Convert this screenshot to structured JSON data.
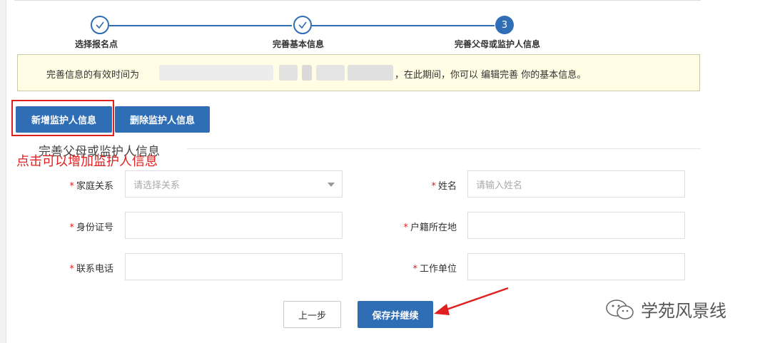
{
  "steps": [
    {
      "label": "选择报名点",
      "state": "done"
    },
    {
      "label": "完善基本信息",
      "state": "done"
    },
    {
      "label": "完善父母或监护人信息",
      "state": "current",
      "number": "3"
    }
  ],
  "notice": {
    "prefix": "完善信息的有效时间为",
    "suffix": "，在此期间，你可以  编辑完善  你的基本信息。"
  },
  "buttons": {
    "add_guardian": "新增监护人信息",
    "delete_guardian": "删除监护人信息",
    "prev": "上一步",
    "save_continue": "保存并继续"
  },
  "section_title": "完善父母或监护人信息",
  "annotation": "点击可以增加监护人信息",
  "form": {
    "relation": {
      "label": "家庭关系",
      "placeholder": "请选择关系"
    },
    "name": {
      "label": "姓名",
      "placeholder": "请输入姓名"
    },
    "id_number": {
      "label": "身份证号",
      "value": ""
    },
    "household": {
      "label": "户籍所在地",
      "value": ""
    },
    "phone": {
      "label": "联系电话",
      "value": ""
    },
    "employer": {
      "label": "工作单位",
      "value": ""
    },
    "required_mark": "*"
  },
  "watermark": "学苑风景线",
  "colors": {
    "primary": "#2f6db5",
    "annotation_red": "#e02020",
    "notice_bg": "#fffde4"
  }
}
